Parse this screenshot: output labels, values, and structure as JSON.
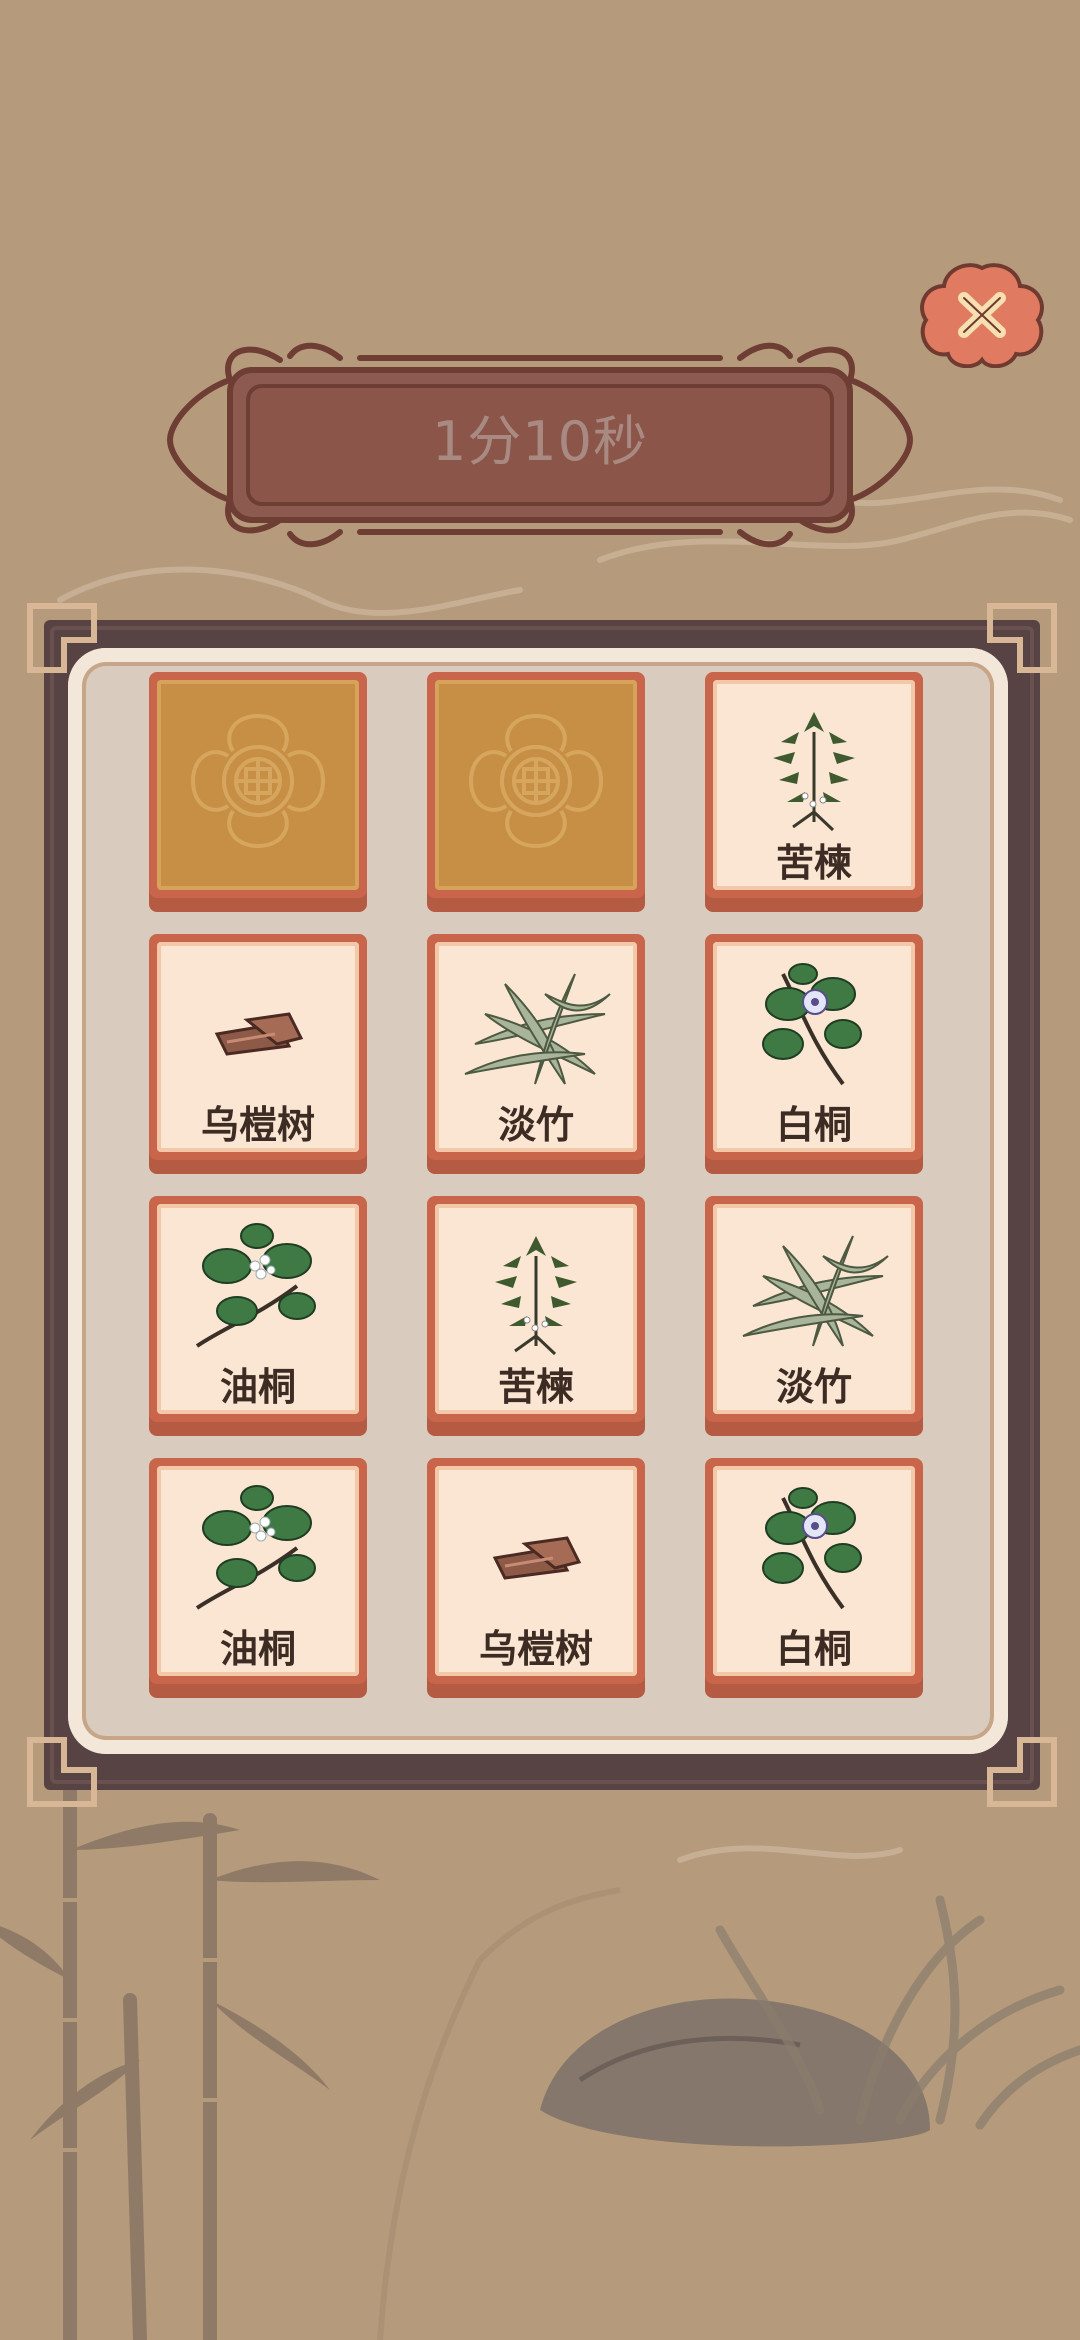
{
  "timer": {
    "text": "1分10秒"
  },
  "close": {
    "icon": "close-icon"
  },
  "colors": {
    "background": "#b59a7b",
    "tile_face": "#fbe6d4",
    "tile_border": "#c8654a",
    "tile_hidden": "#c78f45",
    "timer_plate": "#8d5a4f",
    "close_button": "#e07a60"
  },
  "tiles": [
    {
      "state": "face-down",
      "label": "",
      "icon": "lucky-pattern-icon"
    },
    {
      "state": "face-down",
      "label": "",
      "icon": "lucky-pattern-icon"
    },
    {
      "state": "face-up",
      "label": "苦楝",
      "icon": "herb-sprig-icon"
    },
    {
      "state": "face-up",
      "label": "乌榿树",
      "icon": "bark-pieces-icon"
    },
    {
      "state": "face-up",
      "label": "淡竹",
      "icon": "bamboo-leaves-icon"
    },
    {
      "state": "face-up",
      "label": "白桐",
      "icon": "flowering-branch-icon"
    },
    {
      "state": "face-up",
      "label": "油桐",
      "icon": "leafy-branch-icon"
    },
    {
      "state": "face-up",
      "label": "苦楝",
      "icon": "herb-sprig-icon"
    },
    {
      "state": "face-up",
      "label": "淡竹",
      "icon": "bamboo-leaves-icon"
    },
    {
      "state": "face-up",
      "label": "油桐",
      "icon": "leafy-branch-icon"
    },
    {
      "state": "face-up",
      "label": "乌榿树",
      "icon": "bark-pieces-icon"
    },
    {
      "state": "face-up",
      "label": "白桐",
      "icon": "flowering-branch-icon"
    }
  ]
}
